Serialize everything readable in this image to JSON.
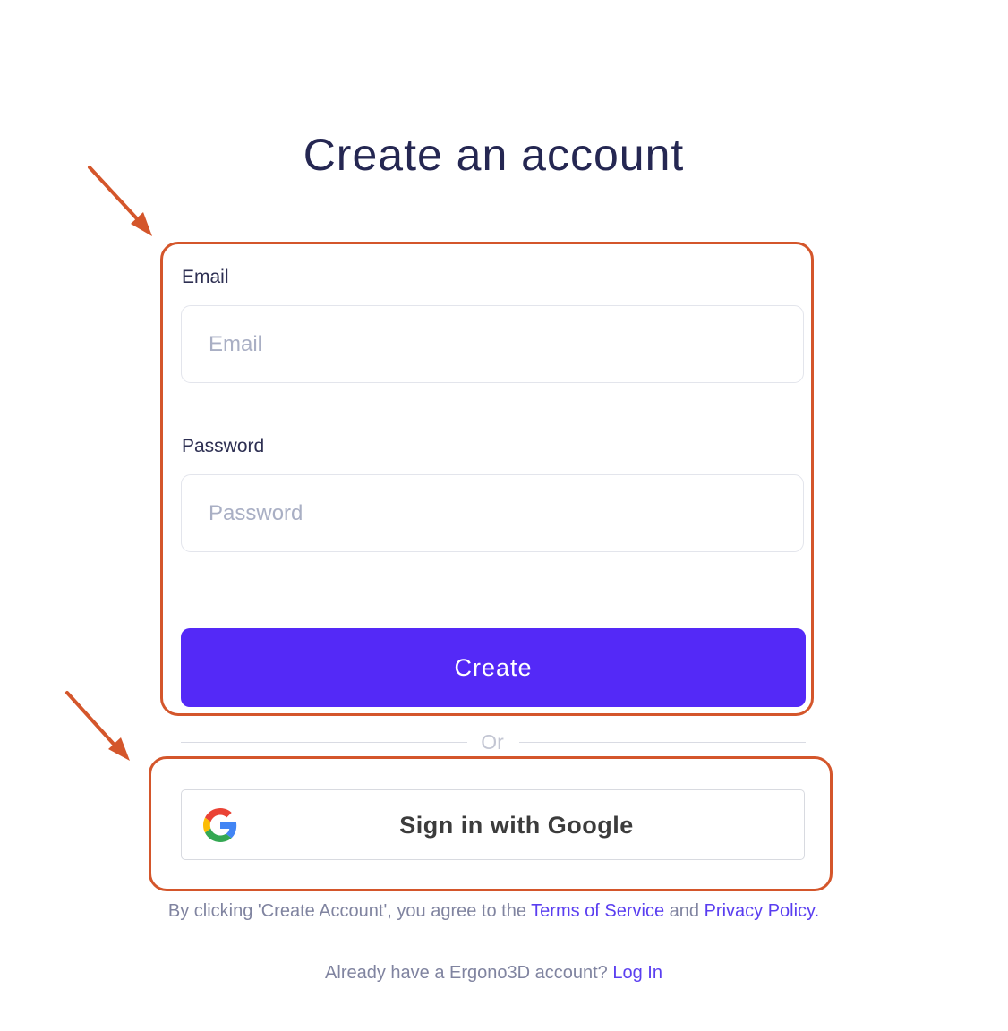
{
  "page": {
    "title": "Create an account"
  },
  "form": {
    "email_label": "Email",
    "email_placeholder": "Email",
    "email_value": "",
    "password_label": "Password",
    "password_placeholder": "Password",
    "password_value": "",
    "create_label": "Create"
  },
  "divider": {
    "or_label": "Or"
  },
  "google": {
    "label": "Sign in with Google",
    "icon": "google-g-icon"
  },
  "terms": {
    "prefix": "By clicking 'Create Account', you agree to the ",
    "tos_label": "Terms of Service",
    "middle": " and ",
    "privacy_label": "Privacy Policy."
  },
  "login": {
    "prefix": "Already have a Ergono3D account? ",
    "link_label": "Log In"
  },
  "colors": {
    "primary": "#5429f7",
    "annotation": "#d4562b",
    "link": "#5a3ef0"
  }
}
